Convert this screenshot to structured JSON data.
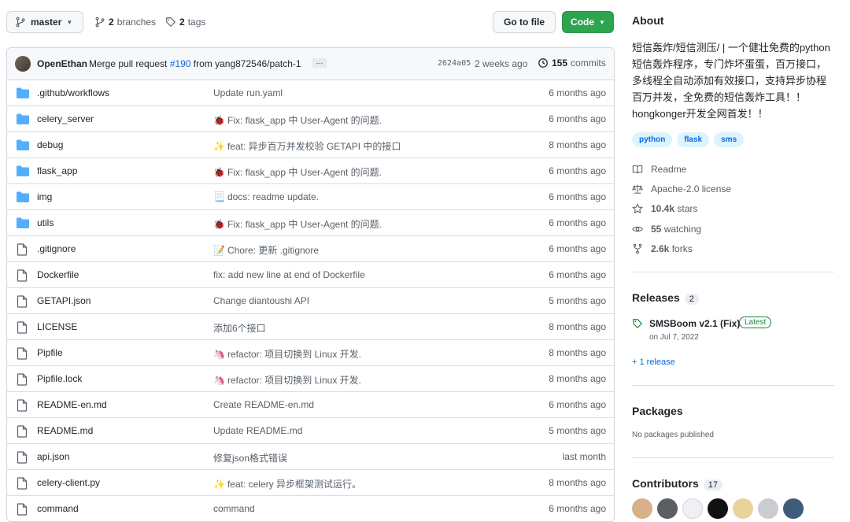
{
  "toolbar": {
    "branch": "master",
    "branches_count": "2",
    "branches_label": "branches",
    "tags_count": "2",
    "tags_label": "tags",
    "goto_file": "Go to file",
    "code": "Code"
  },
  "latest_commit": {
    "author": "OpenEthan",
    "message_prefix": "Merge pull request",
    "pr": "#190",
    "message_suffix": "from yang872546/patch-1",
    "ellipsis": "…",
    "sha": "2624a05",
    "time": "2 weeks ago",
    "commits_count": "155",
    "commits_label": "commits"
  },
  "files": [
    {
      "type": "dir",
      "name": ".github/workflows",
      "emoji": "",
      "message": "Update run.yaml",
      "time": "6 months ago"
    },
    {
      "type": "dir",
      "name": "celery_server",
      "emoji": "🐞",
      "message": "Fix: flask_app 中 User-Agent 的问题.",
      "time": "6 months ago"
    },
    {
      "type": "dir",
      "name": "debug",
      "emoji": "✨",
      "message": "feat: 异步百万并发校验 GETAPI 中的接口",
      "time": "8 months ago"
    },
    {
      "type": "dir",
      "name": "flask_app",
      "emoji": "🐞",
      "message": "Fix: flask_app 中 User-Agent 的问题.",
      "time": "6 months ago"
    },
    {
      "type": "dir",
      "name": "img",
      "emoji": "📃",
      "message": "docs: readme update.",
      "time": "6 months ago"
    },
    {
      "type": "dir",
      "name": "utils",
      "emoji": "🐞",
      "message": "Fix: flask_app 中 User-Agent 的问题.",
      "time": "6 months ago"
    },
    {
      "type": "file",
      "name": ".gitignore",
      "emoji": "📝",
      "message": "Chore: 更新 .gitignore",
      "time": "6 months ago"
    },
    {
      "type": "file",
      "name": "Dockerfile",
      "emoji": "",
      "message": "fix: add new line at end of Dockerfile",
      "time": "6 months ago"
    },
    {
      "type": "file",
      "name": "GETAPI.json",
      "emoji": "",
      "message": "Change diantoushi API",
      "time": "5 months ago"
    },
    {
      "type": "file",
      "name": "LICENSE",
      "emoji": "",
      "message": "添加6个接口",
      "time": "8 months ago"
    },
    {
      "type": "file",
      "name": "Pipfile",
      "emoji": "🦄",
      "message": "refactor: 项目切换到 Linux 开发.",
      "time": "8 months ago"
    },
    {
      "type": "file",
      "name": "Pipfile.lock",
      "emoji": "🦄",
      "message": "refactor: 项目切换到 Linux 开发.",
      "time": "8 months ago"
    },
    {
      "type": "file",
      "name": "README-en.md",
      "emoji": "",
      "message": "Create README-en.md",
      "time": "6 months ago"
    },
    {
      "type": "file",
      "name": "README.md",
      "emoji": "",
      "message": "Update README.md",
      "time": "5 months ago"
    },
    {
      "type": "file",
      "name": "api.json",
      "emoji": "",
      "message": "修复json格式错误",
      "time": "last month"
    },
    {
      "type": "file",
      "name": "celery-client.py",
      "emoji": "✨",
      "message": "feat: celery 异步框架测试运行。",
      "time": "8 months ago"
    },
    {
      "type": "file",
      "name": "command",
      "emoji": "",
      "message": "command",
      "time": "6 months ago"
    }
  ],
  "about": {
    "title": "About",
    "description": "短信轰炸/短信测压/ | 一个健壮免费的python短信轰炸程序，专门炸坏蛋蛋，百万接口，多线程全自动添加有效接口，支持异步协程百万并发，全免费的短信轰炸工具！！hongkonger开发全网首发！！",
    "topics": [
      "python",
      "flask",
      "sms"
    ],
    "readme": "Readme",
    "license": "Apache-2.0 license",
    "stars": "10.4k",
    "stars_label": "stars",
    "watching": "55",
    "watching_label": "watching",
    "forks": "2.6k",
    "forks_label": "forks"
  },
  "releases": {
    "title": "Releases",
    "count": "2",
    "latest_name": "SMSBoom v2.1 (Fix)",
    "latest_badge": "Latest",
    "latest_date": "on Jul 7, 2022",
    "more": "+ 1 release"
  },
  "packages": {
    "title": "Packages",
    "empty": "No packages published"
  },
  "contributors": {
    "title": "Contributors",
    "count": "17"
  },
  "colors": {
    "folder": "#54aeff",
    "link": "#0969da",
    "code_button": "#2da44e"
  }
}
